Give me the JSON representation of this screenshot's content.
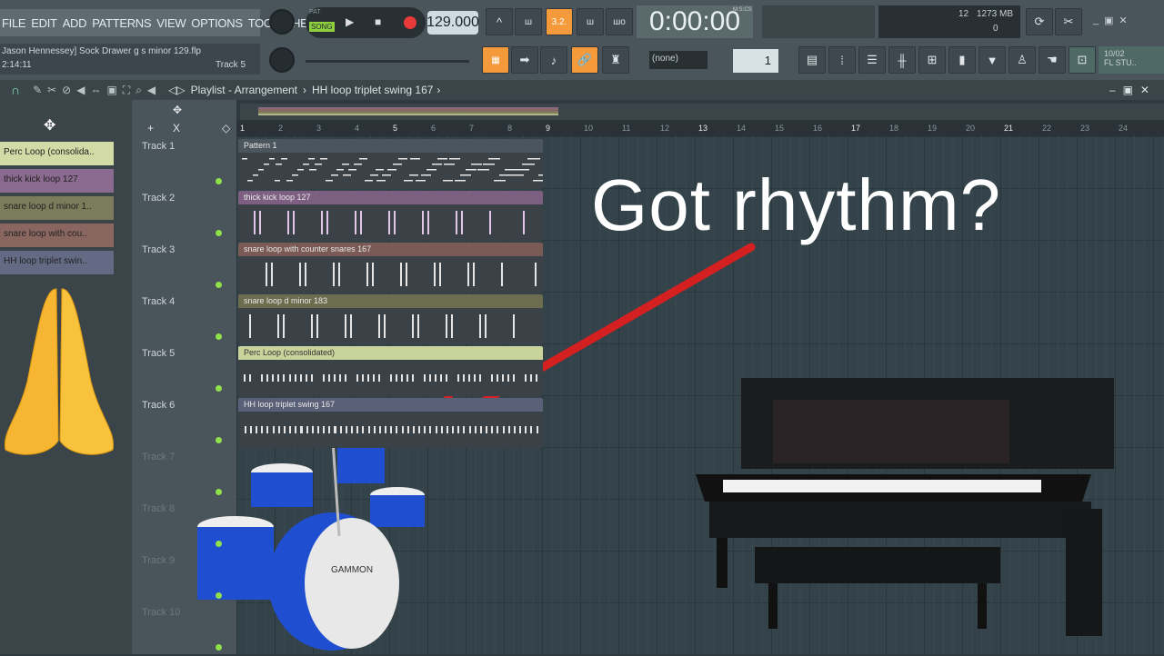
{
  "menu": [
    "FILE",
    "EDIT",
    "ADD",
    "PATTERNS",
    "VIEW",
    "OPTIONS",
    "TOOLS",
    "HELP"
  ],
  "info": {
    "project": "Jason Hennessey] Sock Drawer g s minor 129.flp",
    "time": "2:14:11",
    "hint": "Track 5"
  },
  "transport": {
    "pat": "PAT",
    "song": "SONG",
    "tempo": "129.000",
    "time": "0:00:00",
    "time_label": "M:S:CS"
  },
  "monitor": {
    "cpu": "12",
    "mem": "1273 MB",
    "poly": "0"
  },
  "snap": "(none)",
  "step": "1",
  "news": {
    "date": "10/02",
    "label": "FL STU.."
  },
  "playlist": {
    "title": "Playlist - Arrangement",
    "pattern": "HH loop triplet swing 167"
  },
  "picker": [
    {
      "label": "Perc Loop (consolida..",
      "color": "#d2dba6"
    },
    {
      "label": "thick kick loop 127",
      "color": "#8a6a8e"
    },
    {
      "label": "snare loop d minor 1..",
      "color": "#7b7c5b"
    },
    {
      "label": "snare loop with cou..",
      "color": "#8a6660"
    },
    {
      "label": "HH loop triplet swin..",
      "color": "#646a84"
    }
  ],
  "ruler": [
    "1",
    "2",
    "3",
    "4",
    "5",
    "6",
    "7",
    "8",
    "9",
    "10",
    "11",
    "12",
    "13",
    "14",
    "15",
    "16",
    "17",
    "18",
    "19",
    "20",
    "21",
    "22",
    "23",
    "24"
  ],
  "tracks": [
    "Track 1",
    "Track 2",
    "Track 3",
    "Track 4",
    "Track 5",
    "Track 6",
    "Track 7",
    "Track 8",
    "Track 9",
    "Track 10"
  ],
  "clips": [
    {
      "label": "Pattern 1",
      "color": "#4b555d"
    },
    {
      "label": "thick kick loop 127",
      "color": "#7d5f82"
    },
    {
      "label": "snare loop with counter snares 167",
      "color": "#7a5a55"
    },
    {
      "label": "snare loop d minor 183",
      "color": "#6c6d4f"
    },
    {
      "label": "Perc Loop (consolidated)",
      "color": "#c9d39c"
    },
    {
      "label": "HH loop triplet swing 167",
      "color": "#5a6078"
    }
  ],
  "overlay": {
    "caption": "Got rhythm?",
    "drum_brand": "GAMMON",
    "arrow_color": "#d42020"
  }
}
